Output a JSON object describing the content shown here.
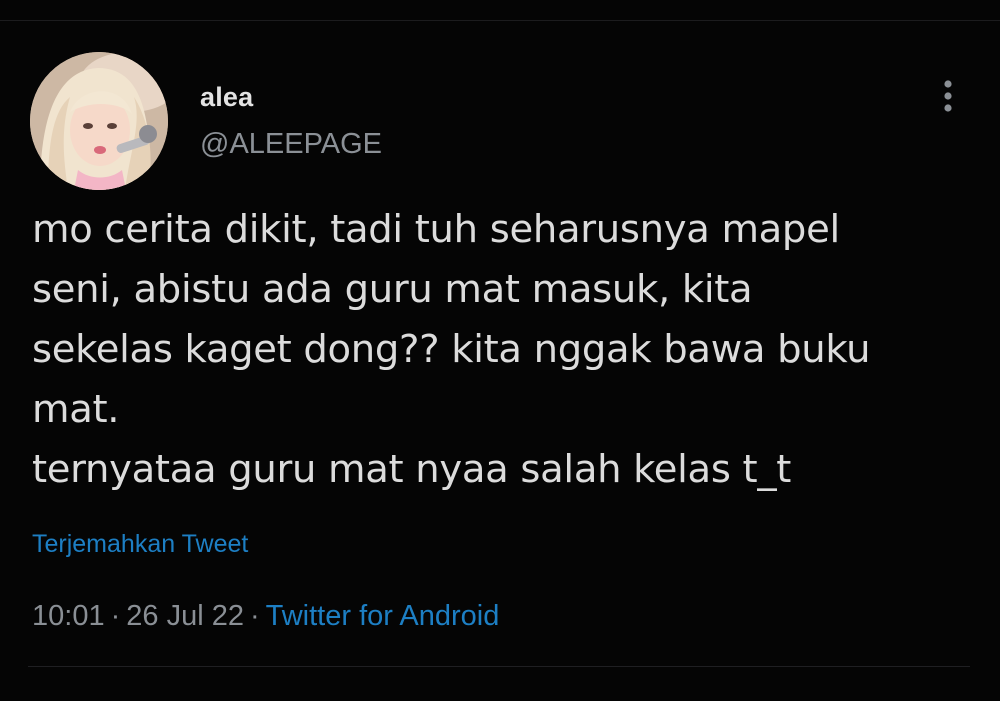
{
  "user": {
    "display_name": "alea",
    "handle": "@ALEEPAGE"
  },
  "tweet": {
    "lines": [
      "mo cerita dikit, tadi tuh seharusnya mapel",
      "seni, abistu ada guru mat masuk, kita",
      "sekelas kaget dong?? kita nggak bawa buku",
      "mat.",
      "ternyataa guru mat nyaa salah kelas t_t"
    ],
    "translate_label": "Terjemahkan Tweet",
    "time": "10:01",
    "date": "26 Jul 22",
    "separator": "·",
    "source": "Twitter for Android"
  },
  "colors": {
    "background": "#050505",
    "text": "#dcdcdc",
    "secondary_text": "#8a8f95",
    "link": "#1d7fc4"
  },
  "icons": {
    "more": "more-vertical-icon",
    "avatar": "user-avatar"
  }
}
